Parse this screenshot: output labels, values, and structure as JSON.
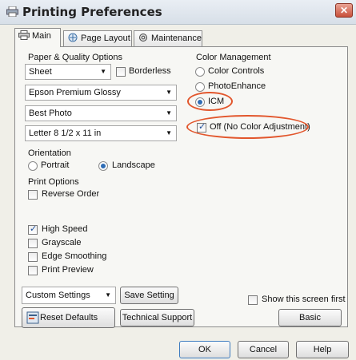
{
  "window": {
    "title": "Printing Preferences",
    "close_symbol": "✕"
  },
  "tabs": [
    {
      "label": "Main",
      "active": true
    },
    {
      "label": "Page Layout",
      "active": false
    },
    {
      "label": "Maintenance",
      "active": false
    }
  ],
  "paper_quality": {
    "heading": "Paper & Quality Options",
    "source": "Sheet",
    "borderless_label": "Borderless",
    "borderless_checked": false,
    "media_type": "Epson Premium Glossy",
    "quality": "Best Photo",
    "size": "Letter 8 1/2 x 11 in"
  },
  "orientation": {
    "heading": "Orientation",
    "portrait_label": "Portrait",
    "landscape_label": "Landscape",
    "selected": "Landscape"
  },
  "print_options": {
    "heading": "Print Options",
    "items": [
      {
        "label": "Reverse Order",
        "checked": false
      },
      {
        "label": "High Speed",
        "checked": true
      },
      {
        "label": "Grayscale",
        "checked": false
      },
      {
        "label": "Edge Smoothing",
        "checked": false
      },
      {
        "label": "Print Preview",
        "checked": false
      }
    ]
  },
  "color_management": {
    "heading": "Color Management",
    "options": [
      "Color Controls",
      "PhotoEnhance",
      "ICM"
    ],
    "selected": "ICM",
    "icm_off_label": "Off (No Color Adjustment)",
    "icm_off_checked": true
  },
  "settings": {
    "custom_settings": "Custom Settings",
    "save_setting": "Save Setting",
    "reset_defaults": "Reset Defaults",
    "technical_support": "Technical Support",
    "show_screen_first": "Show this screen first",
    "basic": "Basic"
  },
  "footer": {
    "ok": "OK",
    "cancel": "Cancel",
    "help": "Help"
  },
  "colors": {
    "highlight": "#e2562c",
    "accent": "#2f6db5"
  }
}
